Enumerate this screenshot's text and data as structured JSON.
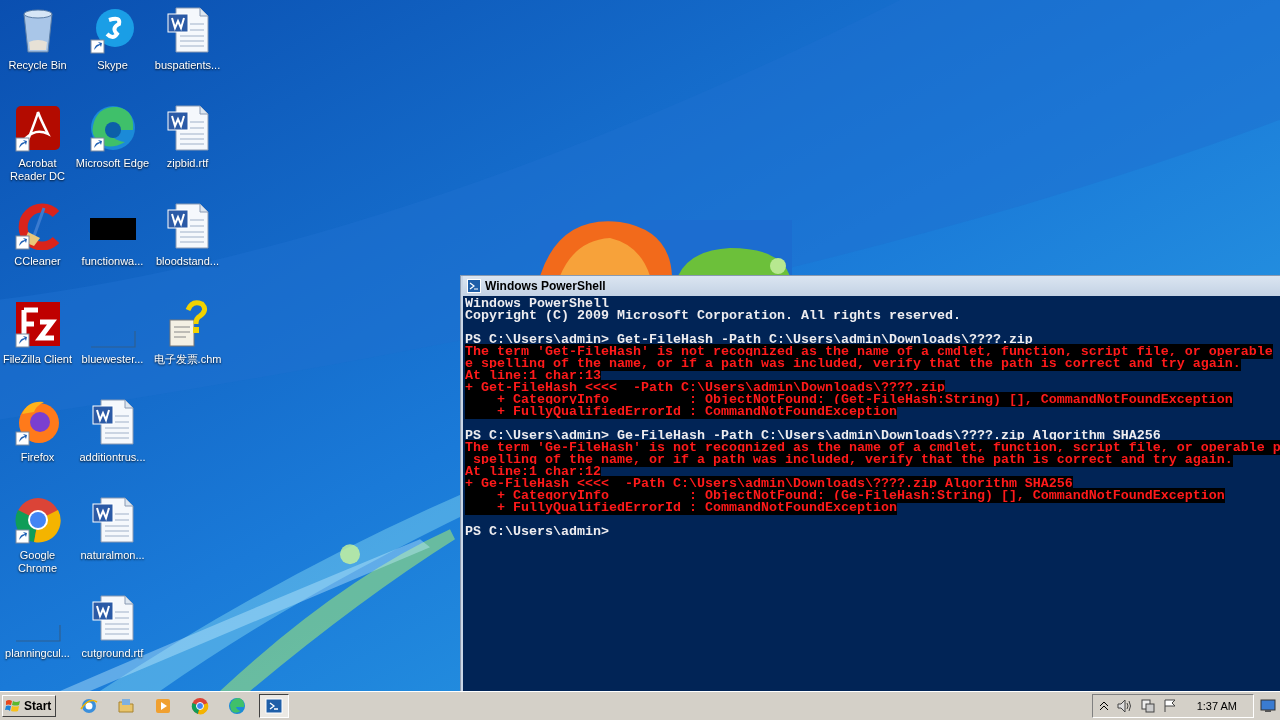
{
  "desktop": {
    "icons": [
      {
        "label": "Recycle Bin",
        "kind": "recycle-bin"
      },
      {
        "label": "Acrobat Reader DC",
        "kind": "acrobat"
      },
      {
        "label": "CCleaner",
        "kind": "ccleaner"
      },
      {
        "label": "FileZilla Client",
        "kind": "filezilla"
      },
      {
        "label": "Firefox",
        "kind": "firefox"
      },
      {
        "label": "Google Chrome",
        "kind": "chrome"
      },
      {
        "label": "planningcul...",
        "kind": "blank"
      },
      {
        "label": "Skype",
        "kind": "skype"
      },
      {
        "label": "Microsoft Edge",
        "kind": "edge"
      },
      {
        "label": "functionwa...",
        "kind": "thumbnail"
      },
      {
        "label": "bluewester...",
        "kind": "blank"
      },
      {
        "label": "additiontrus...",
        "kind": "word"
      },
      {
        "label": "naturalmon...",
        "kind": "word"
      },
      {
        "label": "cutground.rtf",
        "kind": "word"
      },
      {
        "label": "buspatients...",
        "kind": "word"
      },
      {
        "label": "zipbid.rtf",
        "kind": "word"
      },
      {
        "label": "bloodstand...",
        "kind": "word"
      },
      {
        "label": "电子发票.chm",
        "kind": "help"
      }
    ]
  },
  "window": {
    "title": "Windows PowerShell",
    "lines": [
      {
        "kind": "output",
        "text": "Windows PowerShell"
      },
      {
        "kind": "output",
        "text": "Copyright (C) 2009 Microsoft Corporation. All rights reserved."
      },
      {
        "kind": "blank"
      },
      {
        "kind": "output",
        "text": "PS C:\\Users\\admin> Get-FileHash -Path C:\\Users\\admin\\Downloads\\????.zip"
      },
      {
        "kind": "error",
        "text": "The term 'Get-FileHash' is not recognized as the name of a cmdlet, function, script file, or operable"
      },
      {
        "kind": "error",
        "text": "e spelling of the name, or if a path was included, verify that the path is correct and try again."
      },
      {
        "kind": "error",
        "text": "At line:1 char:13"
      },
      {
        "kind": "error",
        "text": "+ Get-FileHash <<<<  -Path C:\\Users\\admin\\Downloads\\????.zip"
      },
      {
        "kind": "error",
        "text": "    + CategoryInfo          : ObjectNotFound: (Get-FileHash:String) [], CommandNotFoundException"
      },
      {
        "kind": "error",
        "text": "    + FullyQualifiedErrorId : CommandNotFoundException"
      },
      {
        "kind": "blank"
      },
      {
        "kind": "output",
        "text": "PS C:\\Users\\admin> Ge-FileHash -Path C:\\Users\\admin\\Downloads\\????.zip Algorithm SHA256"
      },
      {
        "kind": "error",
        "text": "The term 'Ge-FileHash' is not recognized as the name of a cmdlet, function, script file, or operable p"
      },
      {
        "kind": "error",
        "text": " spelling of the name, or if a path was included, verify that the path is correct and try again."
      },
      {
        "kind": "error",
        "text": "At line:1 char:12"
      },
      {
        "kind": "error",
        "text": "+ Ge-FileHash <<<<  -Path C:\\Users\\admin\\Downloads\\????.zip Algorithm SHA256"
      },
      {
        "kind": "error",
        "text": "    + CategoryInfo          : ObjectNotFound: (Ge-FileHash:String) [], CommandNotFoundException"
      },
      {
        "kind": "error",
        "text": "    + FullyQualifiedErrorId : CommandNotFoundException"
      },
      {
        "kind": "blank"
      },
      {
        "kind": "output",
        "text": "PS C:\\Users\\admin>"
      }
    ]
  },
  "taskbar": {
    "start": "Start",
    "apps": [
      {
        "kind": "ie",
        "selected": false
      },
      {
        "kind": "explorer",
        "selected": false
      },
      {
        "kind": "media",
        "selected": false
      },
      {
        "kind": "chrome",
        "selected": false
      },
      {
        "kind": "edge",
        "selected": false
      },
      {
        "kind": "powershell",
        "selected": true
      }
    ],
    "clock": "1:37 AM"
  }
}
